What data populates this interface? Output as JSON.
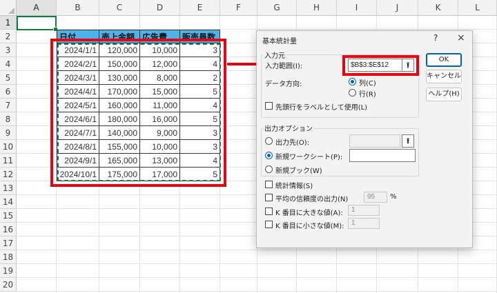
{
  "sheet": {
    "columns": [
      "A",
      "B",
      "C",
      "D",
      "E",
      "F",
      "G",
      "H",
      "I",
      "J",
      "K",
      "L"
    ],
    "rows": [
      "1",
      "2",
      "3",
      "4",
      "5",
      "6",
      "7",
      "8",
      "9",
      "10",
      "11",
      "12",
      "13",
      "14",
      "15",
      "16",
      "17",
      "18",
      "19",
      "20"
    ],
    "headers": [
      "日付",
      "売上金額",
      "広告費",
      "販売員数"
    ],
    "data": [
      [
        "2024/1/1",
        "120,000",
        "10,000",
        "3"
      ],
      [
        "2024/2/1",
        "150,000",
        "12,000",
        "4"
      ],
      [
        "2024/3/1",
        "130,000",
        "8,000",
        "2"
      ],
      [
        "2024/4/1",
        "170,000",
        "15,000",
        "5"
      ],
      [
        "2024/5/1",
        "160,000",
        "11,000",
        "4"
      ],
      [
        "2024/6/1",
        "180,000",
        "16,000",
        "5"
      ],
      [
        "2024/7/1",
        "140,000",
        "9,000",
        "3"
      ],
      [
        "2024/8/1",
        "155,000",
        "10,000",
        "3"
      ],
      [
        "2024/9/1",
        "165,000",
        "13,000",
        "4"
      ],
      [
        "2024/10/1",
        "175,000",
        "17,000",
        "5"
      ]
    ],
    "header_fill": "#4fb3e8"
  },
  "highlight_color": "#e60012",
  "dialog": {
    "title": "基本統計量",
    "help": "?",
    "close": "×",
    "input_group": "入力元",
    "input_range_label": "入力範囲(I):",
    "input_range_value": "$B$3:$E$12",
    "ref_button": "⭱",
    "direction_label": "データ方向:",
    "direction_col": "列(C)",
    "direction_row": "行(R)",
    "first_row_label": "先頭行をラベルとして使用(L)",
    "output_group": "出力オプション",
    "output_range": "出力先(O):",
    "new_sheet": "新規ワークシート(P):",
    "new_book": "新規ブック(W)",
    "summary_stats": "統計情報(S)",
    "confidence": "平均の信頼度の出力(N)",
    "confidence_value": "95",
    "percent": "%",
    "kth_largest": "K 番目に大きな値(A):",
    "kth_largest_value": "1",
    "kth_smallest": "K 番目に小さな値(M):",
    "kth_smallest_value": "1",
    "ok": "OK",
    "cancel": "キャンセル",
    "help_button": "ヘルプ(H)"
  }
}
